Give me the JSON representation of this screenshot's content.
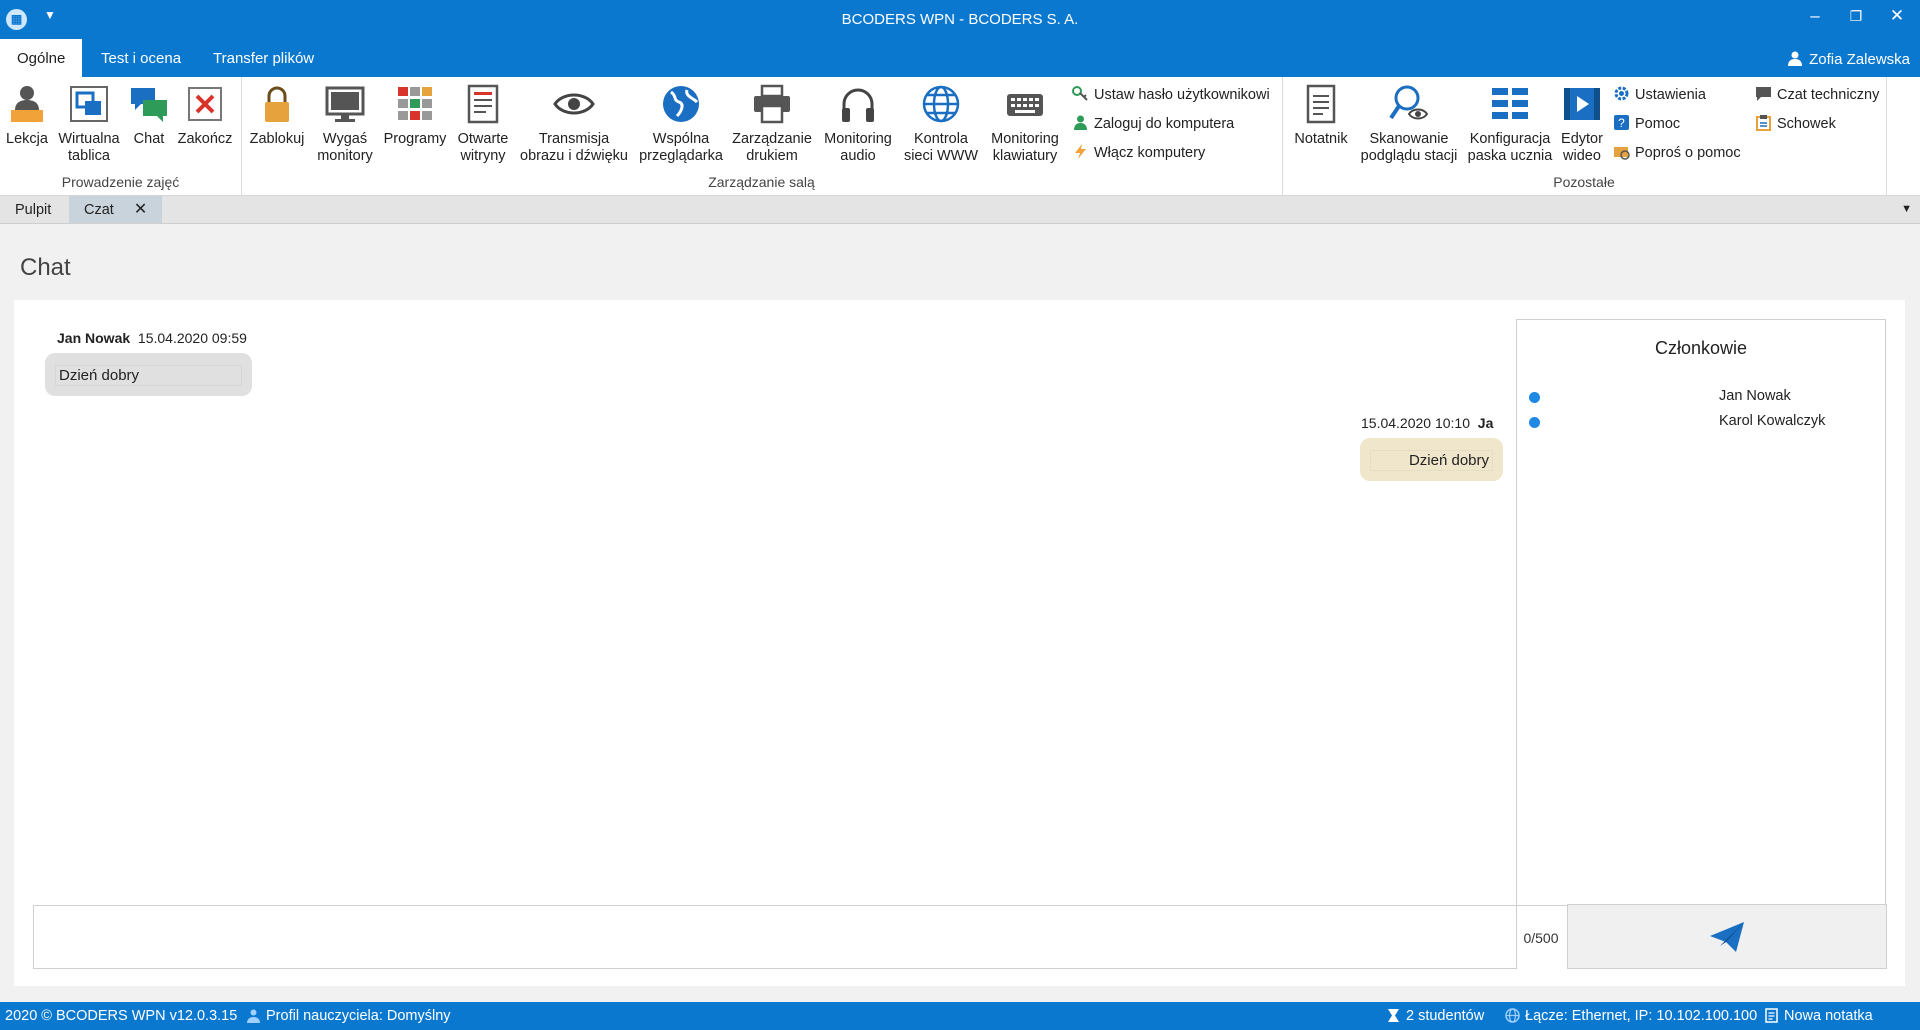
{
  "window": {
    "title": "BCODERS WPN - BCODERS S. A.",
    "app_icon": "app-logo-icon",
    "controls": [
      "minimize-icon",
      "restore-icon",
      "close-icon"
    ]
  },
  "ribbon_tabs": [
    {
      "label": "Ogólne",
      "active": true
    },
    {
      "label": "Test i ocena",
      "active": false
    },
    {
      "label": "Transfer plików",
      "active": false
    }
  ],
  "user": {
    "name": "Zofia Zalewska",
    "icon": "user-icon"
  },
  "ribbon": {
    "groups": [
      {
        "label": "Prowadzenie zajęć"
      },
      {
        "label": "Zarządzanie salą"
      },
      {
        "label": "Pozostałe"
      }
    ],
    "buttons": [
      {
        "l1": "Lekcja",
        "l2": "",
        "icon": "teacher-icon"
      },
      {
        "l1": "Wirtualna",
        "l2": "tablica",
        "icon": "whiteboard-icon"
      },
      {
        "l1": "Chat",
        "l2": "",
        "icon": "chat-icon"
      },
      {
        "l1": "Zakończ",
        "l2": "",
        "icon": "end-lesson-icon"
      },
      {
        "l1": "Zablokuj",
        "l2": "",
        "icon": "lock-icon"
      },
      {
        "l1": "Wygaś",
        "l2": "monitory",
        "icon": "monitor-icon"
      },
      {
        "l1": "Programy",
        "l2": "",
        "icon": "apps-grid-icon"
      },
      {
        "l1": "Otwarte",
        "l2": "witryny",
        "icon": "web-page-icon"
      },
      {
        "l1": "Transmisja",
        "l2": "obrazu i dźwięku",
        "icon": "eye-icon"
      },
      {
        "l1": "Wspólna",
        "l2": "przeglądarka",
        "icon": "globe-icon"
      },
      {
        "l1": "Zarządzanie",
        "l2": "drukiem",
        "icon": "printer-icon"
      },
      {
        "l1": "Monitoring",
        "l2": "audio",
        "icon": "headphones-icon"
      },
      {
        "l1": "Kontrola",
        "l2": "sieci WWW",
        "icon": "network-globe-icon"
      },
      {
        "l1": "Monitoring",
        "l2": "klawiatury",
        "icon": "keyboard-icon"
      },
      {
        "l1": "Notatnik",
        "l2": "",
        "icon": "notepad-icon"
      },
      {
        "l1": "Skanowanie",
        "l2": "podglądu stacji",
        "icon": "scan-search-icon"
      },
      {
        "l1": "Konfiguracja",
        "l2": "paska ucznia",
        "icon": "toolbar-config-icon"
      },
      {
        "l1": "Edytor",
        "l2": "wideo",
        "icon": "video-editor-icon"
      }
    ],
    "small_buttons": [
      {
        "label": "Ustaw hasło użytkownikowi",
        "icon": "key-icon"
      },
      {
        "label": "Zaloguj do komputera",
        "icon": "login-user-icon"
      },
      {
        "label": "Włącz komputery",
        "icon": "power-bolt-icon"
      },
      {
        "label": "Ustawienia",
        "icon": "gear-icon"
      },
      {
        "label": "Pomoc",
        "icon": "help-icon"
      },
      {
        "label": "Poproś o pomoc",
        "icon": "ask-help-icon"
      },
      {
        "label": "Czat techniczny",
        "icon": "tech-chat-icon"
      },
      {
        "label": "Schowek",
        "icon": "clipboard-icon"
      }
    ]
  },
  "doc_tabs": [
    {
      "label": "Pulpit",
      "active": false
    },
    {
      "label": "Czat",
      "active": true
    }
  ],
  "chat": {
    "heading": "Chat",
    "messages": [
      {
        "sender": "Jan Nowak",
        "time": "15.04.2020 09:59",
        "text": "Dzień dobry",
        "side": "left"
      },
      {
        "sender": "Ja",
        "time": "15.04.2020 10:10",
        "text": "Dzień dobry",
        "side": "right"
      }
    ],
    "members_title": "Członkowie",
    "members": [
      {
        "name": "Jan Nowak",
        "status": "online"
      },
      {
        "name": "Karol Kowalczyk",
        "status": "online"
      }
    ],
    "input": {
      "value": "",
      "placeholder": ""
    },
    "counter": "0/500",
    "send_icon": "send-icon"
  },
  "status": {
    "copyright": "2020 ©  BCODERS WPN v12.0.3.15",
    "profile": "Profil nauczyciela: Domyślny",
    "students": "2 studentów",
    "connection": "Łącze: Ethernet, IP: 10.102.100.100",
    "note": "Nowa notatka"
  },
  "colors": {
    "accent": "#0b78d0",
    "bubble_incoming": "#e0e0e0",
    "bubble_outgoing": "#efe6cc",
    "online": "#1e88e5"
  }
}
